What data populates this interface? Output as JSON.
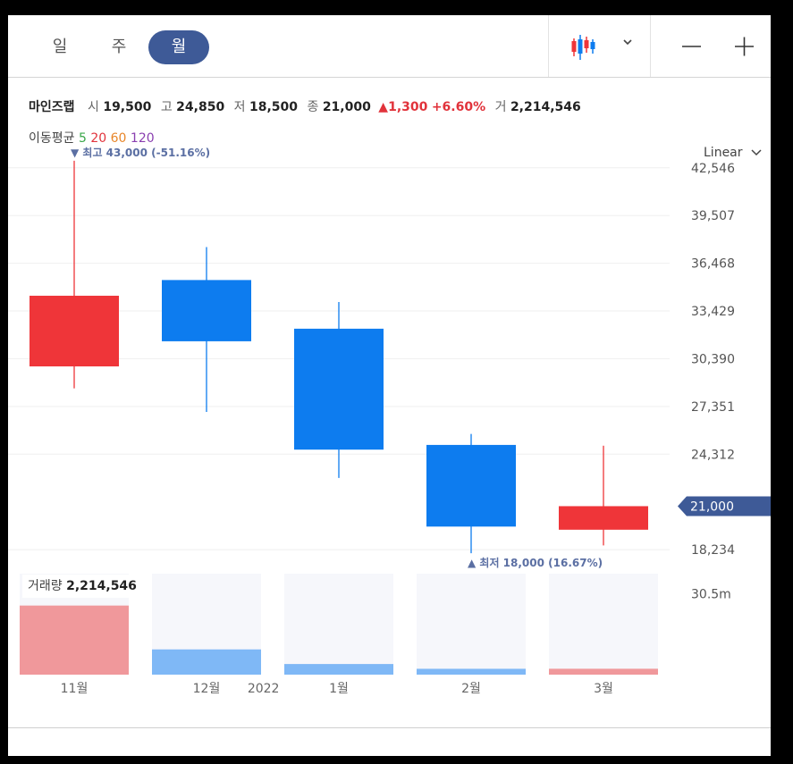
{
  "toolbar": {
    "periods": [
      {
        "label": "일",
        "active": false
      },
      {
        "label": "주",
        "active": false
      },
      {
        "label": "월",
        "active": true
      }
    ]
  },
  "info": {
    "name": "마인즈랩",
    "open_label": "시",
    "open": "19,500",
    "high_label": "고",
    "high": "24,850",
    "low_label": "저",
    "low": "18,500",
    "close_label": "종",
    "close": "21,000",
    "change": "1,300",
    "change_pct": "+6.60%",
    "volume_label": "거",
    "volume": "2,214,546"
  },
  "ma": {
    "label": "이동평균",
    "periods": [
      {
        "label": "5",
        "color": "#3aa74a"
      },
      {
        "label": "20",
        "color": "#e1333b"
      },
      {
        "label": "60",
        "color": "#e8862a"
      },
      {
        "label": "120",
        "color": "#8a3fb0"
      }
    ]
  },
  "scale": {
    "label": "Linear"
  },
  "colors": {
    "up": "#ef3539",
    "down": "#0d7cef",
    "vol_up": "#f0989b",
    "vol_down": "#7fb8f6",
    "vol_bg": "#f6f7fb",
    "current_tag": "#3e5a97"
  },
  "chart_data": {
    "type": "candlestick",
    "categories": [
      "11월",
      "12월",
      "1월",
      "2월",
      "3월"
    ],
    "candles": [
      {
        "open": 29900,
        "high": 43000,
        "low": 28500,
        "close": 34400
      },
      {
        "open": 35400,
        "high": 37500,
        "low": 27000,
        "close": 31500
      },
      {
        "open": 32300,
        "high": 34000,
        "low": 22800,
        "close": 24600
      },
      {
        "open": 24900,
        "high": 25600,
        "low": 18000,
        "close": 19700
      },
      {
        "open": 19500,
        "high": 24850,
        "low": 18500,
        "close": 21000
      }
    ],
    "y_ticks": [
      {
        "value": 42546,
        "label": "42,546"
      },
      {
        "value": 39507,
        "label": "39,507"
      },
      {
        "value": 36468,
        "label": "36,468"
      },
      {
        "value": 33429,
        "label": "33,429"
      },
      {
        "value": 30390,
        "label": "30,390"
      },
      {
        "value": 27351,
        "label": "27,351"
      },
      {
        "value": 24312,
        "label": "24,312"
      },
      {
        "value": 18234,
        "label": "18,234"
      }
    ],
    "ylim": [
      17100,
      43900
    ],
    "current": {
      "value": 21000,
      "label": "21,000"
    },
    "annotations": {
      "high": {
        "value": 43000,
        "index": 0,
        "text": "▼ 최고 43,000 (-51.16%)"
      },
      "low": {
        "value": 18000,
        "index": 3,
        "text": "▲ 최저 18,000 (16.67%)"
      }
    },
    "x_labels": [
      {
        "index": 0,
        "label": "11월"
      },
      {
        "index": 1,
        "label": "12월"
      },
      {
        "pos": 1.43,
        "label": "2022"
      },
      {
        "index": 2,
        "label": "1월"
      },
      {
        "index": 3,
        "label": "2월"
      },
      {
        "index": 4,
        "label": "3월"
      }
    ],
    "volume": {
      "label": "거래량",
      "current": "2,214,546",
      "tick": {
        "value": 30500000,
        "label": "30.5m"
      },
      "max": 38000000,
      "values": [
        26000000,
        9500000,
        4000000,
        2200000,
        2214546
      ]
    }
  }
}
